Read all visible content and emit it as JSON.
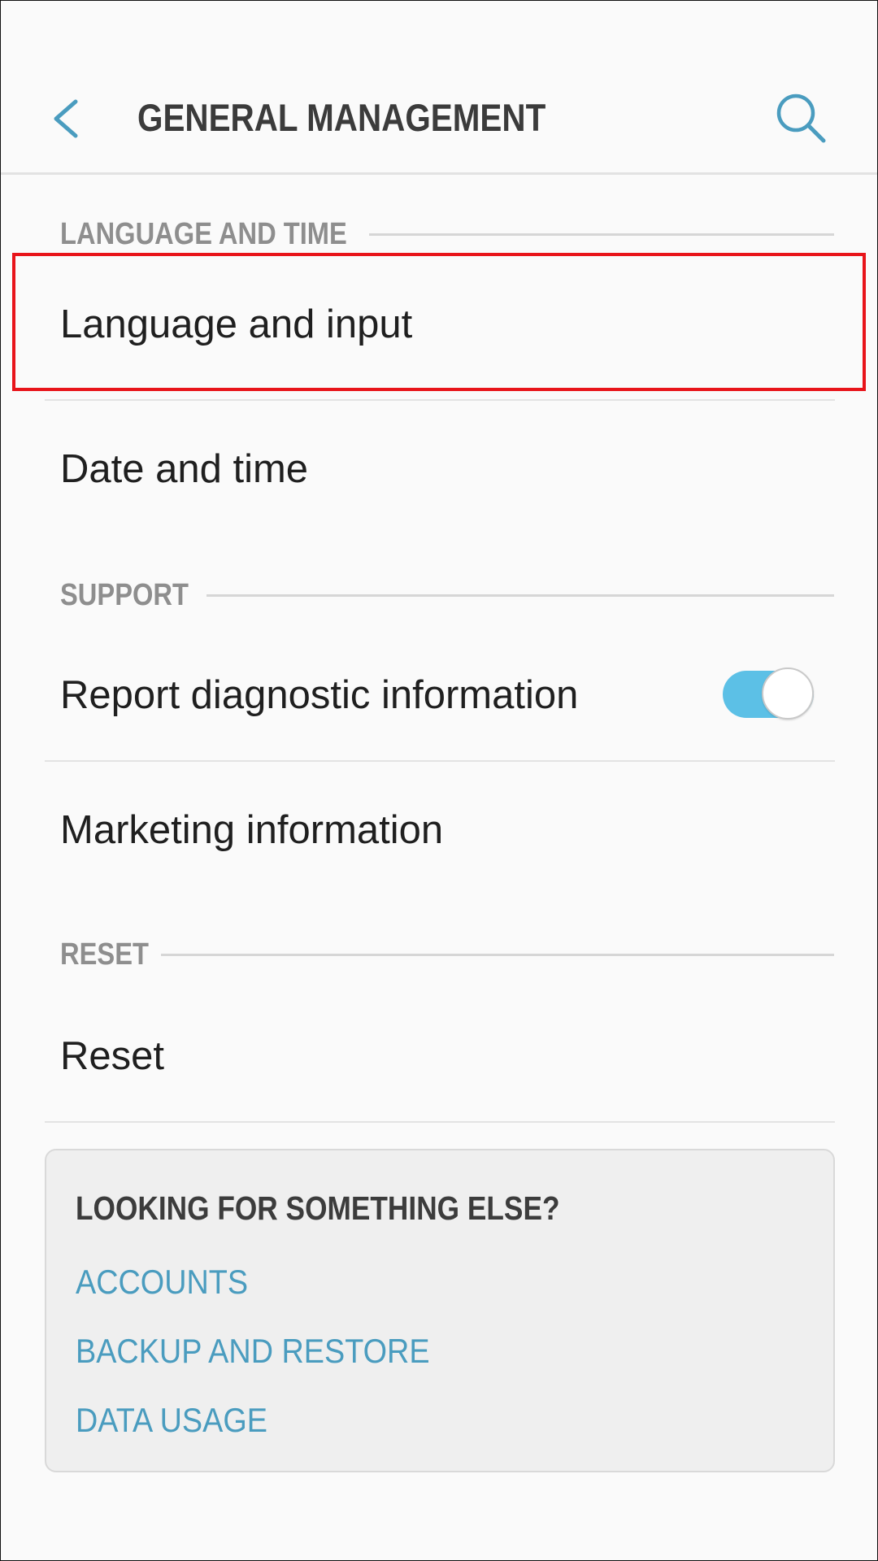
{
  "header": {
    "title": "GENERAL MANAGEMENT",
    "back_icon": "chevron-left-icon",
    "search_icon": "search-icon"
  },
  "sections": {
    "language_and_time": {
      "label": "LANGUAGE AND TIME",
      "items": [
        "Language and input",
        "Date and time"
      ]
    },
    "support": {
      "label": "SUPPORT",
      "items": [
        "Report diagnostic information",
        "Marketing information"
      ]
    },
    "reset": {
      "label": "RESET",
      "items": [
        "Reset"
      ]
    }
  },
  "toggles": {
    "report_diagnostic": true
  },
  "card": {
    "title": "LOOKING FOR SOMETHING ELSE?",
    "links": [
      "ACCOUNTS",
      "BACKUP AND RESTORE",
      "DATA USAGE"
    ]
  },
  "colors": {
    "accent": "#4a9cbf",
    "toggle_on": "#5cc0e6",
    "highlight": "#e8141a",
    "section_label": "#8e8e8e",
    "text": "#1f1f1f"
  }
}
